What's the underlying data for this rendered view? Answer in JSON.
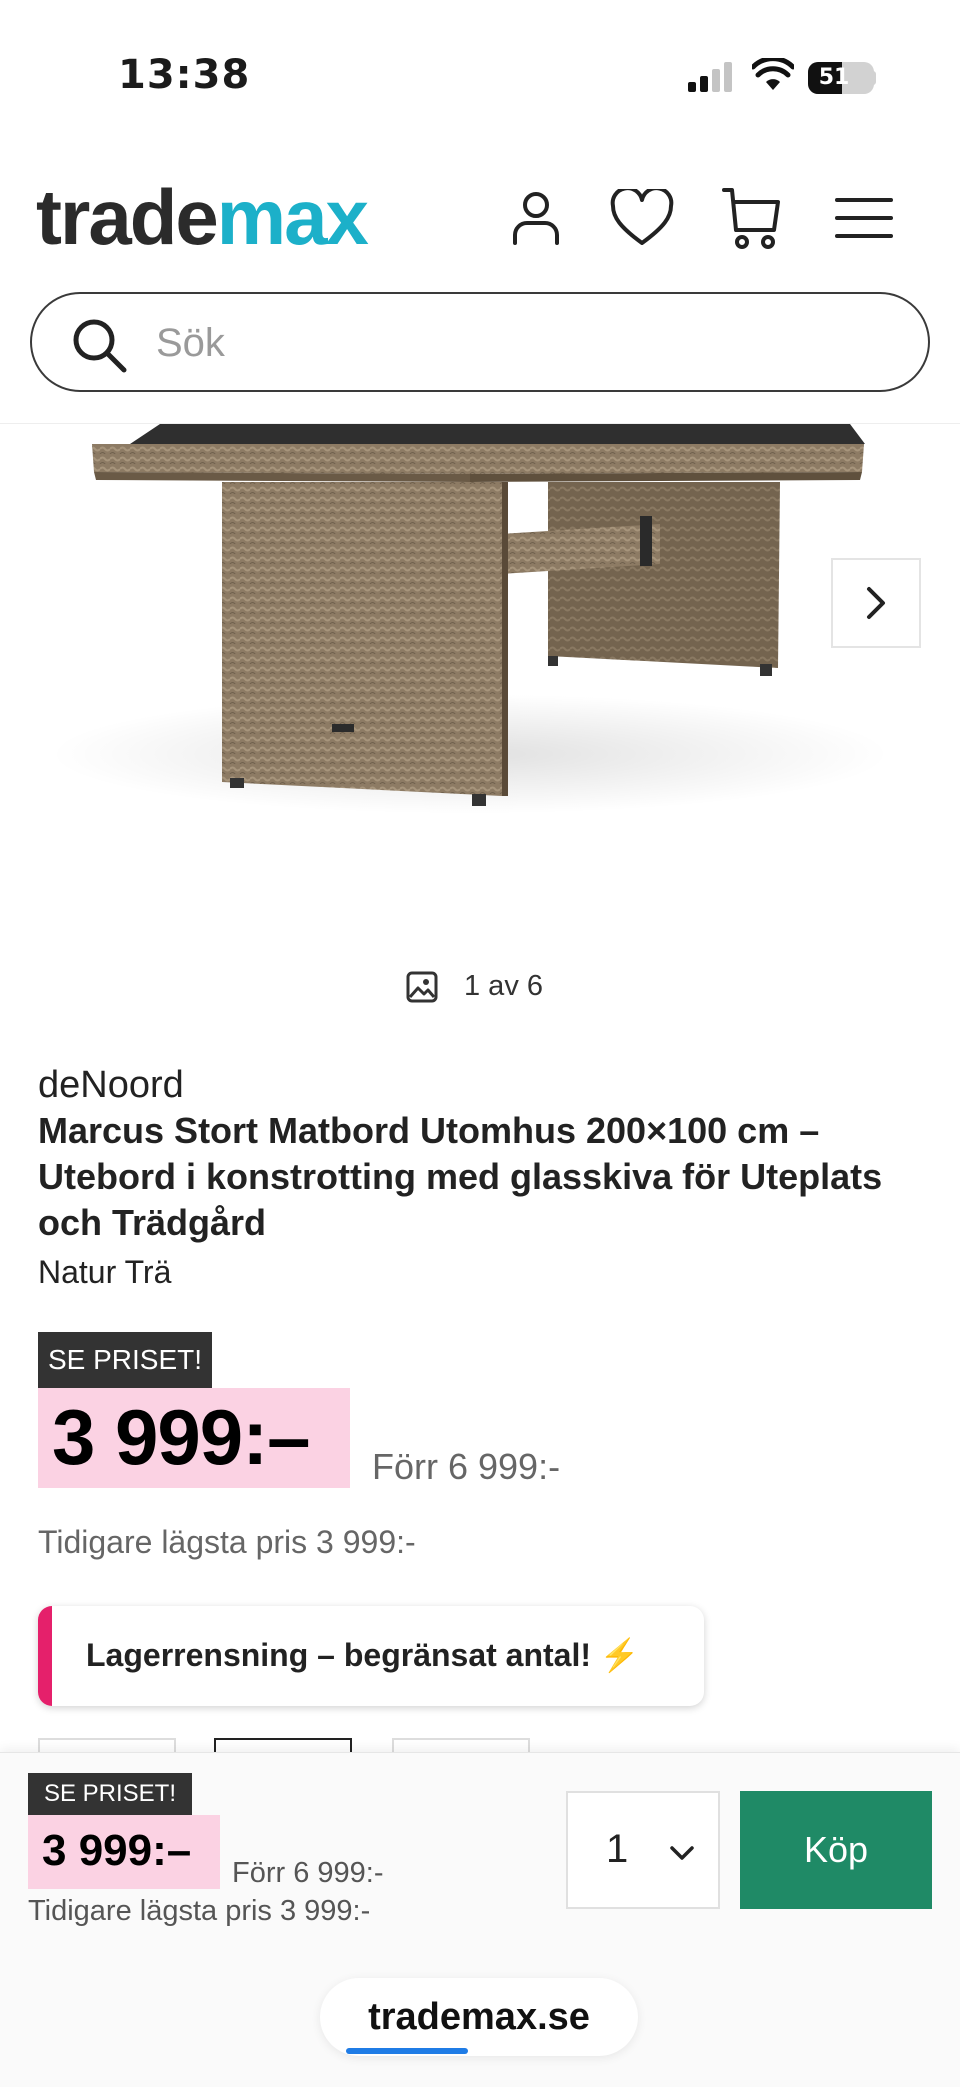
{
  "status": {
    "time": "13:38",
    "battery": "51"
  },
  "header": {
    "logo_part1": "trade",
    "logo_part2": "max",
    "logo_accent": "#1cb0c9",
    "icons": [
      "user-icon",
      "heart-icon",
      "cart-icon",
      "menu-icon"
    ]
  },
  "search": {
    "placeholder": "Sök"
  },
  "gallery": {
    "counter": "1 av 6",
    "icons": [
      "chevron-right-icon",
      "image-icon"
    ]
  },
  "product": {
    "brand": "deNoord",
    "title": "Marcus Stort Matbord Utomhus 200×100 cm – Utebord i konstrotting med glasskiva för Uteplats och Trädgård",
    "variant": "Natur Trä",
    "promo_tag": "SE PRISET!",
    "price": "3 999:–",
    "price_before": "Förr 6 999:-",
    "lowest_price": "Tidigare lägsta pris 3 999:-",
    "banner_text": "Lagerrensning – begränsat antal! ⚡",
    "banner_accent": "#e5206b",
    "price_bg": "#fbd2e3"
  },
  "sticky_bar": {
    "promo_tag": "SE PRISET!",
    "price": "3 999:–",
    "price_before": "Förr 6 999:-",
    "lowest_price": "Tidigare lägsta pris 3 999:-",
    "quantity": "1",
    "buy_label": "Köp",
    "buy_color": "#1f8a66"
  },
  "browser": {
    "url": "trademax.se"
  }
}
